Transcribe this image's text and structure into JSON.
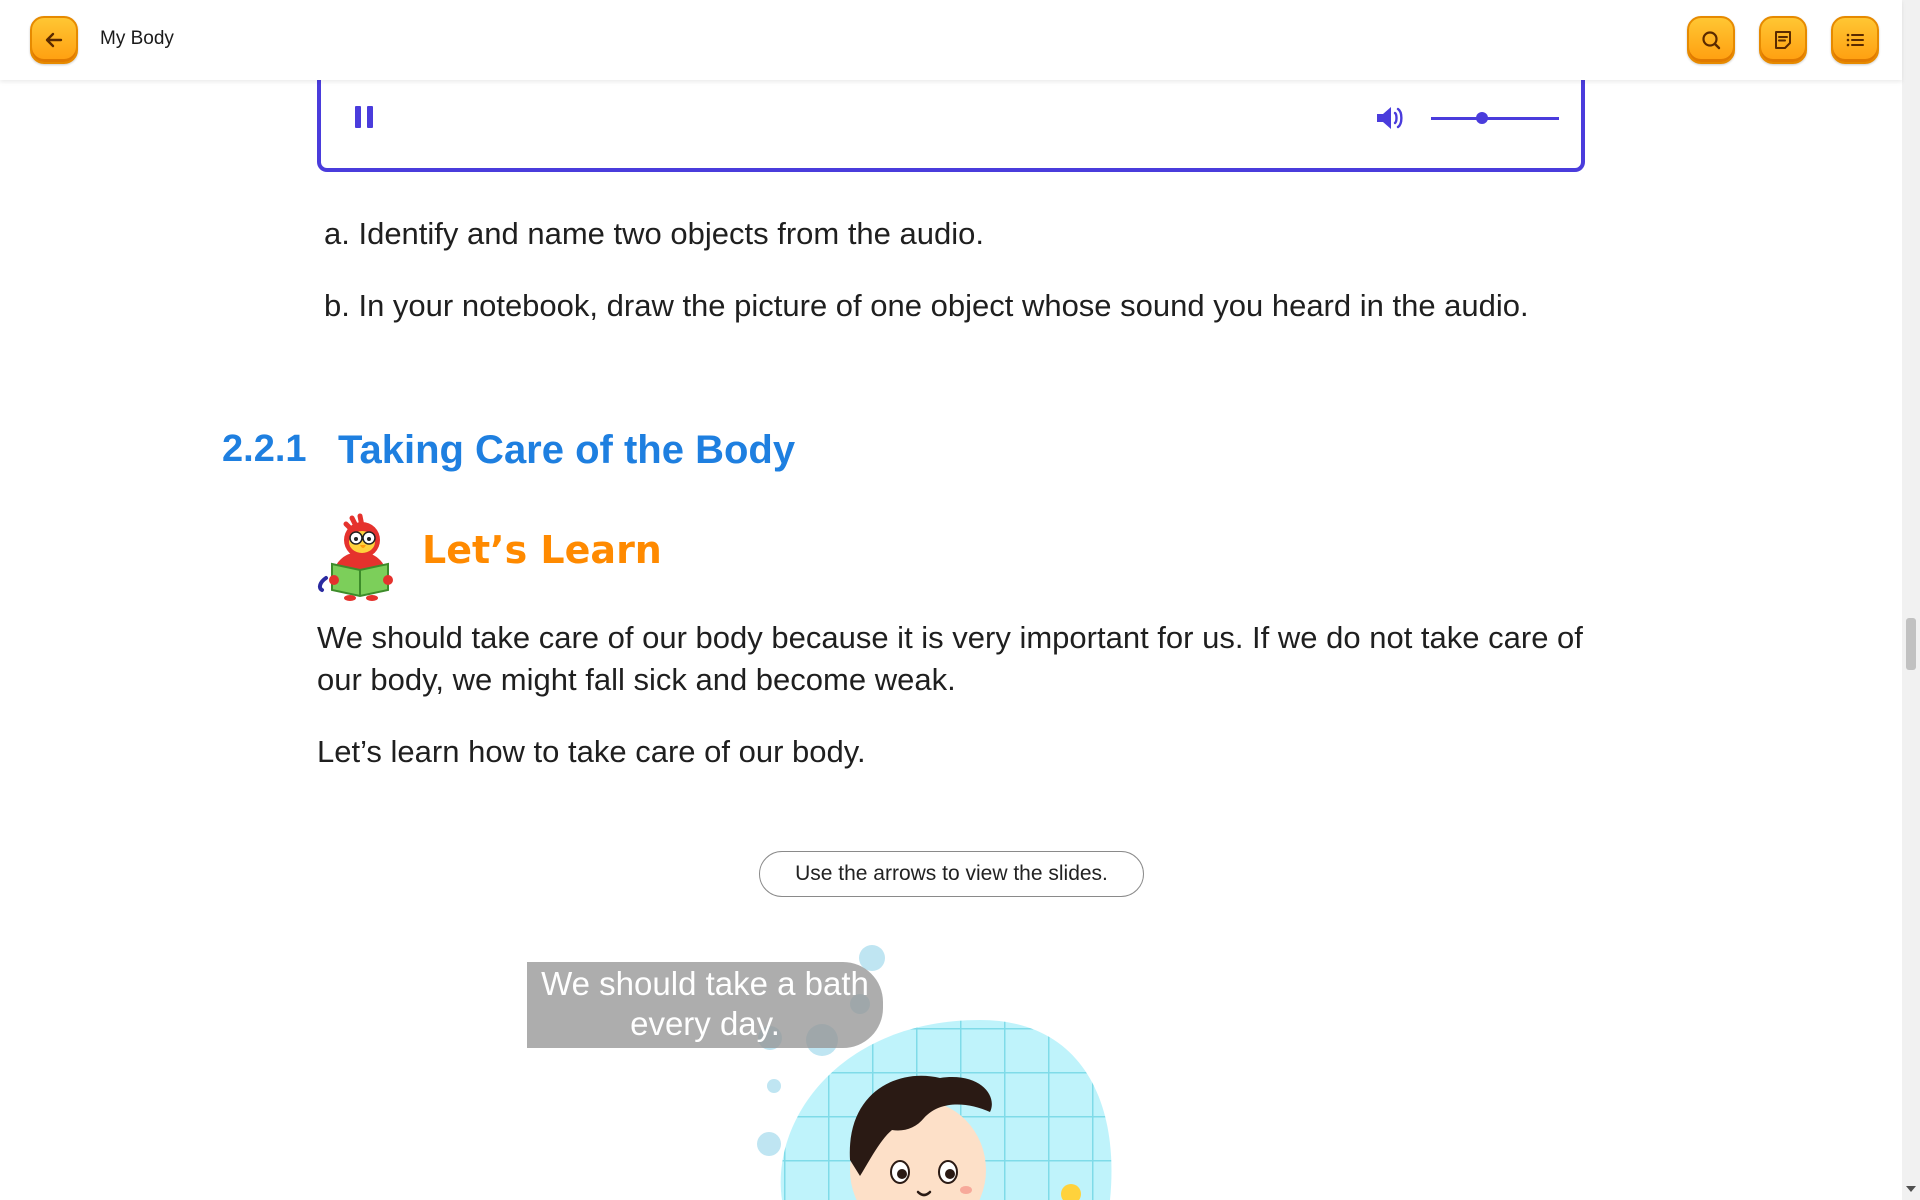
{
  "header": {
    "title": "My Body",
    "back_icon": "arrow-left-icon",
    "search_icon": "search-icon",
    "notes_icon": "notes-icon",
    "menu_icon": "list-menu-icon",
    "accent_color": "#ffb020"
  },
  "audio_player": {
    "state": "playing",
    "volume_level": 0.4,
    "accent_color": "#4a3cdc"
  },
  "questions": [
    "a. Identify and name two objects from the audio.",
    "b. In your notebook, draw the picture of one object whose sound you heard in the audio."
  ],
  "section": {
    "number": "2.2.1",
    "title": "Taking Care of the Body"
  },
  "lets_learn": {
    "label": "Let’s Learn",
    "paragraphs": [
      "We should take care of our body because it is very important for us. If we do not take care of our body, we might fall sick and become weak.",
      "Let’s learn how to take care of our body."
    ]
  },
  "slides": {
    "hint": "Use the arrows to view the slides.",
    "caption": "We should take a bath every day."
  }
}
